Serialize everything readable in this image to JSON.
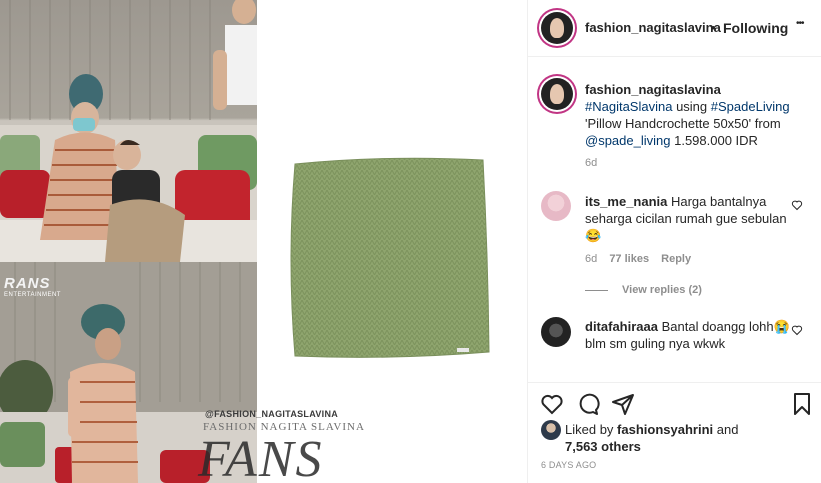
{
  "post": {
    "media": {
      "watermark_handle": "@FASHION_NAGITASLAVINA",
      "watermark_name": "FASHION NAGITA SLAVINA",
      "watermark_fans": "FANS",
      "tv_logo_text": "RANS",
      "tv_logo_sub": "ENTERTAINMENT"
    },
    "header": {
      "username": "fashion_nagitaslavina",
      "separator": "•",
      "follow_status": "Following",
      "more": "•••"
    },
    "caption": {
      "username": "fashion_nagitaslavina",
      "hashtag1": "#NagitaSlavina",
      "text1": " using ",
      "hashtag2": "#SpadeLiving",
      "text2": " 'Pillow Handcrochette 50x50' from ",
      "mention": "@spade_living",
      "text3": " 1.598.000 IDR",
      "age": "6d"
    },
    "comments": [
      {
        "username": "its_me_nania",
        "text": " Harga bantalnya seharga cicilan rumah gue sebulan 😂",
        "age": "6d",
        "likes": "77 likes",
        "reply": "Reply",
        "view_replies": "View replies (2)"
      },
      {
        "username": "ditafahiraaa",
        "text": " Bantal doangg lohh😭 blm sm guling nya wkwk"
      }
    ],
    "likes": {
      "liked_by_prefix": "Liked by ",
      "liked_by_user": "fashionsyahrini",
      "and": " and",
      "others": "7,563 others"
    },
    "timestamp": "6 DAYS AGO"
  }
}
